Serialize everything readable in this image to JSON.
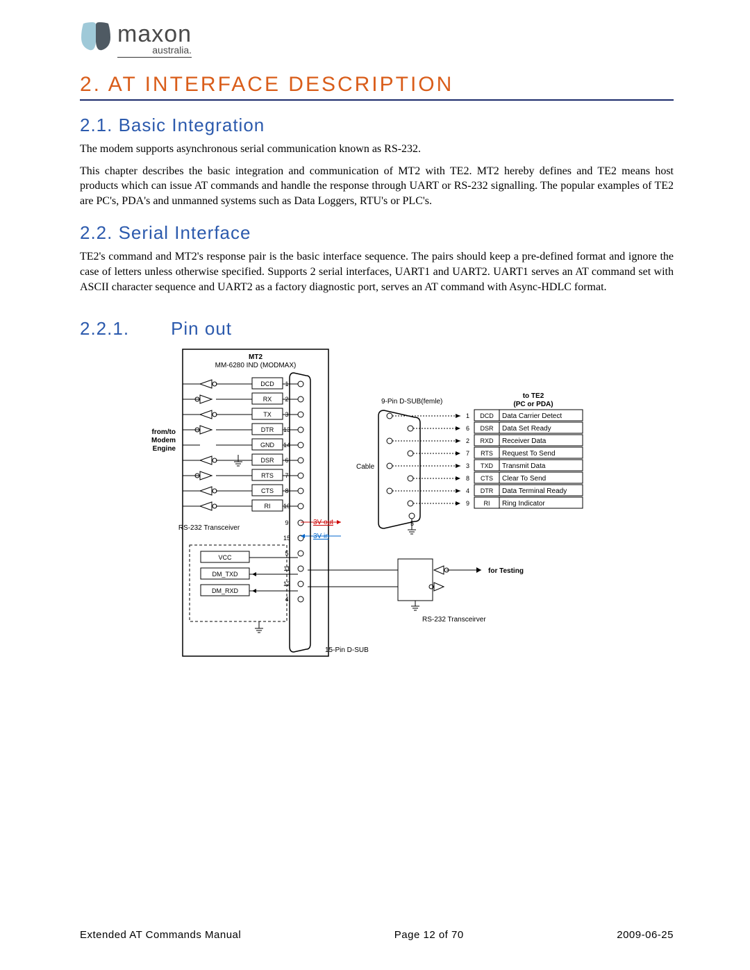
{
  "logo": {
    "word": "maxon",
    "sub": "australia."
  },
  "h1": "2.  AT INTERFACE DESCRIPTION",
  "s21": {
    "title": "2.1.  Basic Integration",
    "p1": "The modem supports asynchronous serial communication known as RS-232.",
    "p2": "This chapter describes the basic integration and communication of MT2 with TE2. MT2 hereby defines   and TE2 means host products which can issue AT commands and handle the response through UART or RS-232 signalling. The popular examples of TE2 are PC's, PDA's and unmanned systems such as Data Loggers, RTU's or PLC's."
  },
  "s22": {
    "title": "2.2.  Serial Interface",
    "p1": "TE2's command and MT2's response pair is the basic interface sequence. The pairs should keep a pre-defined format and ignore the case of letters unless otherwise specified.   Supports 2 serial interfaces, UART1 and UART2. UART1 serves an AT command set with ASCII character sequence and UART2 as a factory diagnostic port, serves an AT command with Async-HDLC format."
  },
  "s221": {
    "num": "2.2.1.",
    "title": "Pin out"
  },
  "diagram": {
    "mt2_title": "MT2",
    "mt2_sub": "MM-6280 IND (MODMAX)",
    "left_label": "from/to\nModem\nEngine",
    "rs232_left": "RS-232 Transceiver",
    "rows": [
      {
        "sig": "DCD",
        "pin": "1"
      },
      {
        "sig": "RX",
        "pin": "2"
      },
      {
        "sig": "TX",
        "pin": "3"
      },
      {
        "sig": "DTR",
        "pin": "13"
      },
      {
        "sig": "GND",
        "pin": "14"
      },
      {
        "sig": "DSR",
        "pin": "6"
      },
      {
        "sig": "RTS",
        "pin": "7"
      },
      {
        "sig": "CTS",
        "pin": "8"
      },
      {
        "sig": "RI",
        "pin": "10"
      }
    ],
    "extra_pins": [
      "9",
      "15",
      "5",
      "11",
      "12",
      "4"
    ],
    "v_labels": {
      "out": "3V out",
      "in": "3V in"
    },
    "dm": [
      "VCC",
      "DM_TXD",
      "DM_RXD"
    ],
    "conn15": "15-Pin D-SUB",
    "conn9": "9-Pin D-SUB(femle)",
    "cable": "Cable",
    "right_title1": "to TE2",
    "right_title2": "(PC or PDA)",
    "right": [
      {
        "pin": "1",
        "sig": "DCD",
        "desc": "Data Carrier Detect"
      },
      {
        "pin": "6",
        "sig": "DSR",
        "desc": "Data Set Ready"
      },
      {
        "pin": "2",
        "sig": "RXD",
        "desc": "Receiver Data"
      },
      {
        "pin": "7",
        "sig": "RTS",
        "desc": "Request To Send"
      },
      {
        "pin": "3",
        "sig": "TXD",
        "desc": "Transmit Data"
      },
      {
        "pin": "8",
        "sig": "CTS",
        "desc": "Clear To Send"
      },
      {
        "pin": "4",
        "sig": "DTR",
        "desc": "Data Terminal Ready"
      },
      {
        "pin": "9",
        "sig": "RI",
        "desc": "Ring Indicator"
      }
    ],
    "pin5": "5",
    "rs232_right": "RS-232 Transceirver",
    "testing": "for Testing"
  },
  "footer": {
    "left": "Extended AT Commands Manual",
    "center": "Page 12 of 70",
    "right": "2009-06-25"
  }
}
